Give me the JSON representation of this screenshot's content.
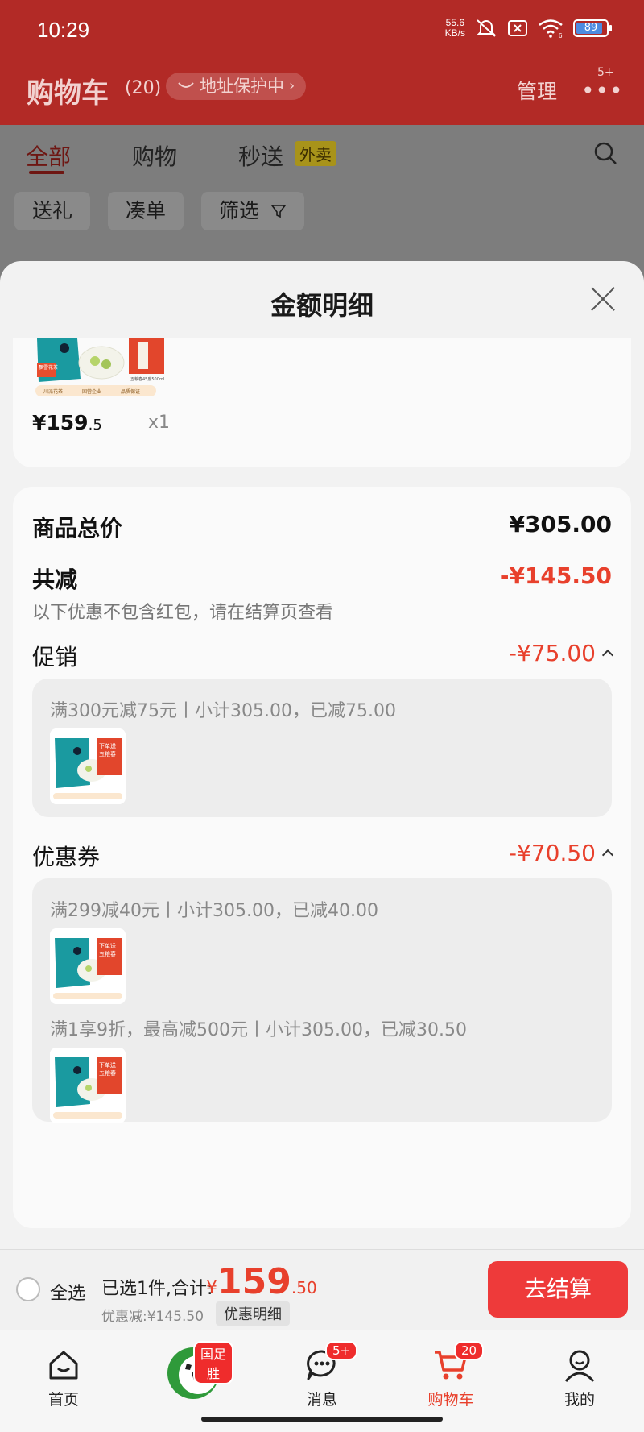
{
  "status_bar": {
    "time": "10:29",
    "net_speed_value": "55.6",
    "net_speed_unit": "KB/s",
    "battery": "89",
    "battery_level": 0.89,
    "wifi_sub": "6"
  },
  "header": {
    "title": "购物车",
    "count": "(20)",
    "address_protect": "地址保护中",
    "manage": "管理",
    "more_badge": "5+"
  },
  "tabs": [
    {
      "label": "全部",
      "active": true
    },
    {
      "label": "购物",
      "active": false
    },
    {
      "label": "秒送",
      "active": false
    }
  ],
  "waimai_tag": "外卖",
  "chips": [
    "送礼",
    "凑单",
    "筛选"
  ],
  "sheet": {
    "title": "金额明细",
    "product": {
      "price_int": "¥159",
      "price_dec": ".5",
      "qty": "x1",
      "image_text": {
        "tea_tag": "飘雪花茶",
        "liquor_name": "五粮春",
        "badges": [
          "川派花茶",
          "国营企业",
          "品质保证"
        ],
        "liquor_spec": "五粮春45度500mL"
      }
    },
    "summary": {
      "total_label": "商品总价",
      "total_value": "¥305.00",
      "discount_label": "共减",
      "discount_value": "-¥145.50",
      "note": "以下优惠不包含红包，请在结算页查看"
    },
    "promotion": {
      "label": "促销",
      "value": "-¥75.00",
      "items": [
        {
          "desc": "满300元减75元丨小计305.00，已减75.00"
        }
      ]
    },
    "coupon": {
      "label": "优惠券",
      "value": "-¥70.50",
      "items": [
        {
          "desc": "满299减40元丨小计305.00，已减40.00"
        },
        {
          "desc": "满1享9折，最高减500元丨小计305.00，已减30.50"
        }
      ]
    },
    "thumb_text": {
      "banner": "下单送",
      "liquor": "五粮春"
    }
  },
  "checkout": {
    "select_all": "全选",
    "selected": "已选1件,合计:",
    "currency": "¥",
    "total_int": "159",
    "total_dec": ".50",
    "discount": "优惠减:¥145.50",
    "detail_chip": "优惠明细",
    "button": "去结算"
  },
  "nav": [
    {
      "label": "首页",
      "icon": "home-icon"
    },
    {
      "label": "",
      "icon": "football-icon",
      "badge": "国足胜"
    },
    {
      "label": "消息",
      "icon": "message-icon",
      "badge": "5+"
    },
    {
      "label": "购物车",
      "icon": "cart-icon",
      "badge": "20",
      "active": true
    },
    {
      "label": "我的",
      "icon": "profile-icon"
    }
  ],
  "colors": {
    "brand_red": "#e8402c",
    "header_red": "#b22a26",
    "button_red": "#ee3a3a"
  }
}
